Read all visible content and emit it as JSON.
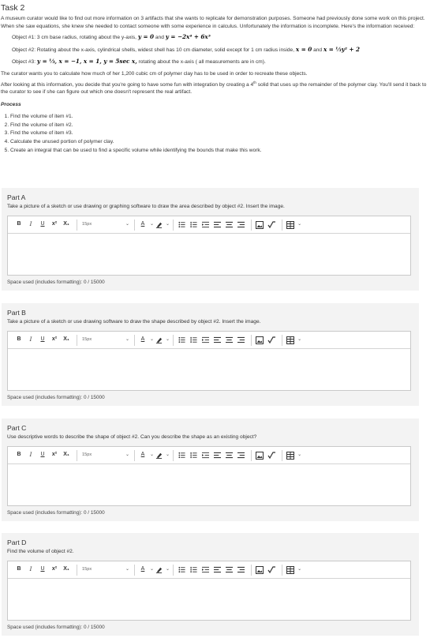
{
  "task": {
    "title": "Task 2",
    "intro": "A museum curator would like to find out more information on 3 artifacts that she wants to replicate for demonstration purposes. Someone had previously done some work on this project. When she saw equations, she knew she needed to contact someone with some experience in calculus. Unfortunately the information is incomplete. Here's the information received:",
    "objects": [
      {
        "text": "Object #1: 3 cm base radius, rotating about the y-axis,",
        "math": "y = 0",
        "mid": "and",
        "math2": "y = −2x⁴ + 6x³"
      },
      {
        "text": "Object #2: Rotating about the x-axis, cylindrical shells, widest shell has 10 cm diameter, solid except for 1 cm radius inside,",
        "math": "x = 0",
        "mid": "and",
        "math2": "x = ⅓y² + 2"
      },
      {
        "text": "Object #3:",
        "math": "y = ⅓, x = −1, x = 1, y = 5sec x,",
        "mid": "rotating about the x-axis ( all measurements are in cm).",
        "math2": ""
      }
    ],
    "clay": "The curator wants you to calculate how much of her 1,200 cubic cm of polymer clay has to be used in order to recreate these objects.",
    "challenge_pre": "After looking at this information, you decide that you're going to have some fun with integration by creating a 4",
    "challenge_sup": "th",
    "challenge_post": " solid that uses up the remainder of the polymer clay. You'll send it back to the curator to see if she can figure out which one doesn't represent the real artifact.",
    "process_label": "Process",
    "steps": [
      "Find the volume of item #1.",
      "Find the volume of item #2.",
      "Find the volume of item #3.",
      "Calculate the unused portion of polymer clay.",
      "Create an integral that can be used to find a specific volume while identifying the bounds that make this work."
    ]
  },
  "toolbar": {
    "bold": "B",
    "italic": "I",
    "underline": "U",
    "superscript": "x²",
    "subscript": "X₁",
    "font_size": "15px",
    "font_color": "A"
  },
  "parts": [
    {
      "title": "Part A",
      "prompt": "Take a picture of a sketch or use drawing or graphing software to draw the area described by object #2. Insert the image.",
      "usage": "Space used (includes formatting): 0 / 15000"
    },
    {
      "title": "Part B",
      "prompt": "Take a picture of a sketch or use drawing software to draw the shape described by object #2. Insert the image.",
      "usage": "Space used (includes formatting): 0 / 15000"
    },
    {
      "title": "Part C",
      "prompt": "Use descriptive words to describe the shape of object #2. Can you describe the shape as an existing object?",
      "usage": "Space used (includes formatting): 0 / 15000"
    },
    {
      "title": "Part D",
      "prompt": "Find the volume of object #2.",
      "usage": "Space used (includes formatting): 0 / 15000"
    }
  ]
}
